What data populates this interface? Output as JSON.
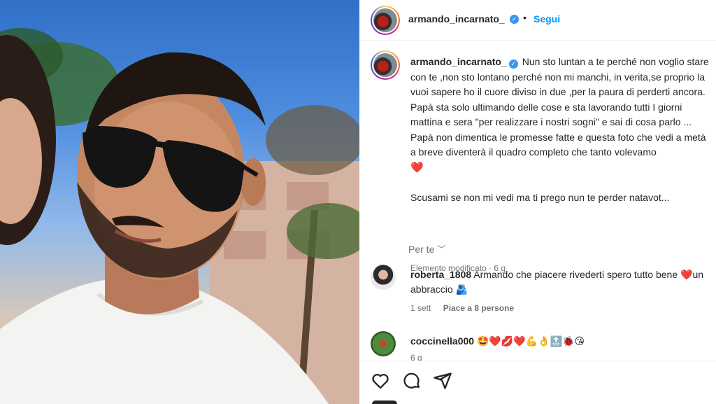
{
  "post": {
    "author": "armando_incarnato_",
    "verified_mark": "✓",
    "separator": "•",
    "follow_label": "Segui"
  },
  "caption": {
    "author": "armando_incarnato_",
    "text": "Nun sto luntan a te perché non voglio stare con te ,non sto lontano perché non mi manchi, in verita,se proprio la vuoi sapere ho il cuore diviso in due ,per la paura di perderti ancora.\nPapà sta solo ultimando delle cose e sta lavorando tutti I giorni mattina e sera \"per realizzare i nostri sogni\" e sai di cosa parlo ...\nPapà non dimentica le promesse fatte e questa foto che vedi a metà a breve diventerà il quadro completo che tanto volevamo",
    "heart": "❤️",
    "text_after": "Scusami se non mi vedi ma ti prego nun te perder natavot...",
    "meta": "Elemento modificato · 6 g"
  },
  "translate": {
    "label": "Per te",
    "chevron": "﹀"
  },
  "comments": [
    {
      "user": "roberta_1808",
      "text": "Armando che piacere rivederti spero tutto bene ❤️un abbraccio 🫂",
      "time": "1 sett",
      "likes": "Piace a 8 persone"
    },
    {
      "user": "coccinella000",
      "text": "🤩❤️💋❤️💪👌🔝🐞😘",
      "time": "6 g"
    }
  ],
  "icons": {
    "like": "heart-outline-icon",
    "comment": "speech-bubble-icon",
    "share": "paper-plane-icon"
  },
  "colors": {
    "link_blue": "#0095f6",
    "verified_blue": "#3897f0",
    "heart_red": "#ed4956",
    "muted": "#737373"
  }
}
